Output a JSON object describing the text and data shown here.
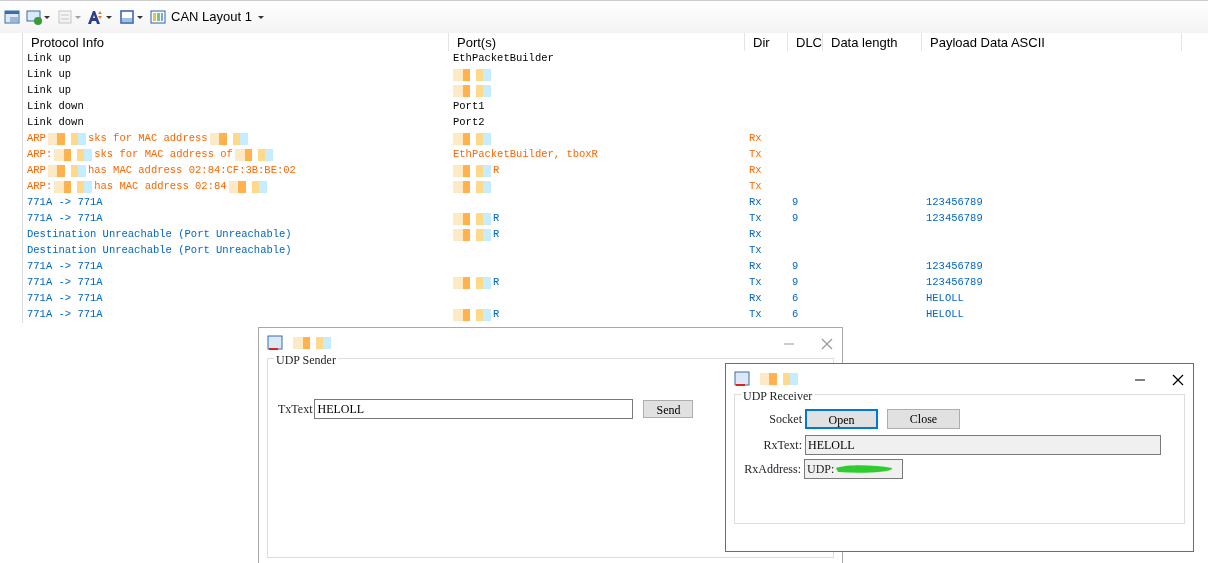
{
  "toolbar": {
    "items": [
      {
        "kind": "icon",
        "dropdown": false,
        "disabled": false
      },
      {
        "kind": "icon",
        "dropdown": true,
        "disabled": false
      },
      {
        "kind": "icon",
        "dropdown": true,
        "disabled": true
      },
      {
        "kind": "icon",
        "dropdown": true,
        "disabled": false
      },
      {
        "kind": "icon",
        "dropdown": true,
        "disabled": false
      },
      {
        "kind": "layout",
        "label": "CAN Layout 1",
        "dropdown": true,
        "disabled": false
      }
    ]
  },
  "table": {
    "columns": [
      "Protocol Info",
      "Port(s)",
      "Dir",
      "DLC",
      "Data length",
      "Payload Data ASCII"
    ],
    "rows": [
      {
        "info": [
          {
            "text": "Link up"
          }
        ],
        "port": [
          {
            "text": "EthPacketBuilder"
          }
        ]
      },
      {
        "info": [
          {
            "text": "Link up"
          }
        ],
        "port": [
          {
            "kind": "redacted"
          }
        ]
      },
      {
        "info": [
          {
            "text": "Link up"
          }
        ],
        "port": [
          {
            "kind": "redacted"
          }
        ]
      },
      {
        "info": [
          {
            "text": "Link down"
          }
        ],
        "port": [
          {
            "text": "Port1"
          }
        ]
      },
      {
        "info": [
          {
            "text": "Link down"
          }
        ],
        "port": [
          {
            "text": "Port2"
          }
        ]
      },
      {
        "color": "#ff6600",
        "info": [
          {
            "text": "ARP"
          },
          {
            "kind": "redacted"
          },
          {
            "text": "sks for MAC address"
          },
          {
            "kind": "redacted"
          }
        ],
        "port": [
          {
            "kind": "redacted"
          }
        ],
        "dir": "Rx"
      },
      {
        "color": "#ff6600",
        "info": [
          {
            "text": "ARP:"
          },
          {
            "kind": "redacted"
          },
          {
            "text": "sks for MAC address of"
          },
          {
            "kind": "redacted"
          }
        ],
        "port": [
          {
            "text": "EthPacketBuilder, tboxR"
          }
        ],
        "dir": "Tx"
      },
      {
        "color": "#ff6600",
        "info": [
          {
            "text": "ARP"
          },
          {
            "kind": "redacted"
          },
          {
            "text": "has MAC address 02:84:CF:3B:BE:02"
          }
        ],
        "port": [
          {
            "kind": "redacted"
          },
          {
            "text": "R"
          }
        ],
        "dir": "Rx"
      },
      {
        "color": "#ff6600",
        "info": [
          {
            "text": "ARP:"
          },
          {
            "kind": "redacted"
          },
          {
            "text": "has MAC address 02:84"
          },
          {
            "kind": "redacted"
          }
        ],
        "port": [
          {
            "kind": "redacted"
          }
        ],
        "dir": "Tx"
      },
      {
        "color": "#0066cc",
        "info": [
          {
            "text": "771A -> 771A"
          }
        ],
        "port": [],
        "dir": "Rx",
        "dlc": "9",
        "payload": "123456789"
      },
      {
        "color": "#0066cc",
        "info": [
          {
            "text": "771A -> 771A"
          }
        ],
        "port": [
          {
            "kind": "redacted"
          },
          {
            "text": "R"
          }
        ],
        "dir": "Tx",
        "dlc": "9",
        "payload": "123456789"
      },
      {
        "color": "#0066cc",
        "info": [
          {
            "text": "Destination Unreachable (Port Unreachable)"
          }
        ],
        "port": [
          {
            "kind": "redacted"
          },
          {
            "text": "R"
          }
        ],
        "dir": "Rx"
      },
      {
        "color": "#0066cc",
        "info": [
          {
            "text": "Destination Unreachable (Port Unreachable)"
          }
        ],
        "port": [],
        "dir": "Tx"
      },
      {
        "color": "#0066cc",
        "info": [
          {
            "text": "771A -> 771A"
          }
        ],
        "port": [],
        "dir": "Rx",
        "dlc": "9",
        "payload": "123456789"
      },
      {
        "color": "#0066cc",
        "info": [
          {
            "text": "771A -> 771A"
          }
        ],
        "port": [
          {
            "kind": "redacted"
          },
          {
            "text": "R"
          }
        ],
        "dir": "Tx",
        "dlc": "9",
        "payload": "123456789"
      },
      {
        "color": "#0066cc",
        "info": [
          {
            "text": "771A -> 771A"
          }
        ],
        "port": [],
        "dir": "Rx",
        "dlc": "6",
        "payload": "HELOLL"
      },
      {
        "color": "#0066cc",
        "info": [
          {
            "text": "771A -> 771A"
          }
        ],
        "port": [
          {
            "kind": "redacted"
          },
          {
            "text": "R"
          }
        ],
        "dir": "Tx",
        "dlc": "6",
        "payload": "HELOLL"
      }
    ]
  },
  "sender_window": {
    "active": false,
    "group": "UDP Sender",
    "tx_label": "TxText",
    "tx_value": "HELOLL",
    "send_button": "Send"
  },
  "receiver_window": {
    "active": true,
    "group": "UDP Receiver",
    "socket_label": "Socket",
    "open_button": {
      "label": "Open",
      "focused": true
    },
    "close_button": {
      "label": "Close",
      "focused": false
    },
    "rx_label": "RxText:",
    "rx_value": "HELOLL",
    "addr_label": "RxAddress:",
    "addr_value": "UDP:"
  }
}
